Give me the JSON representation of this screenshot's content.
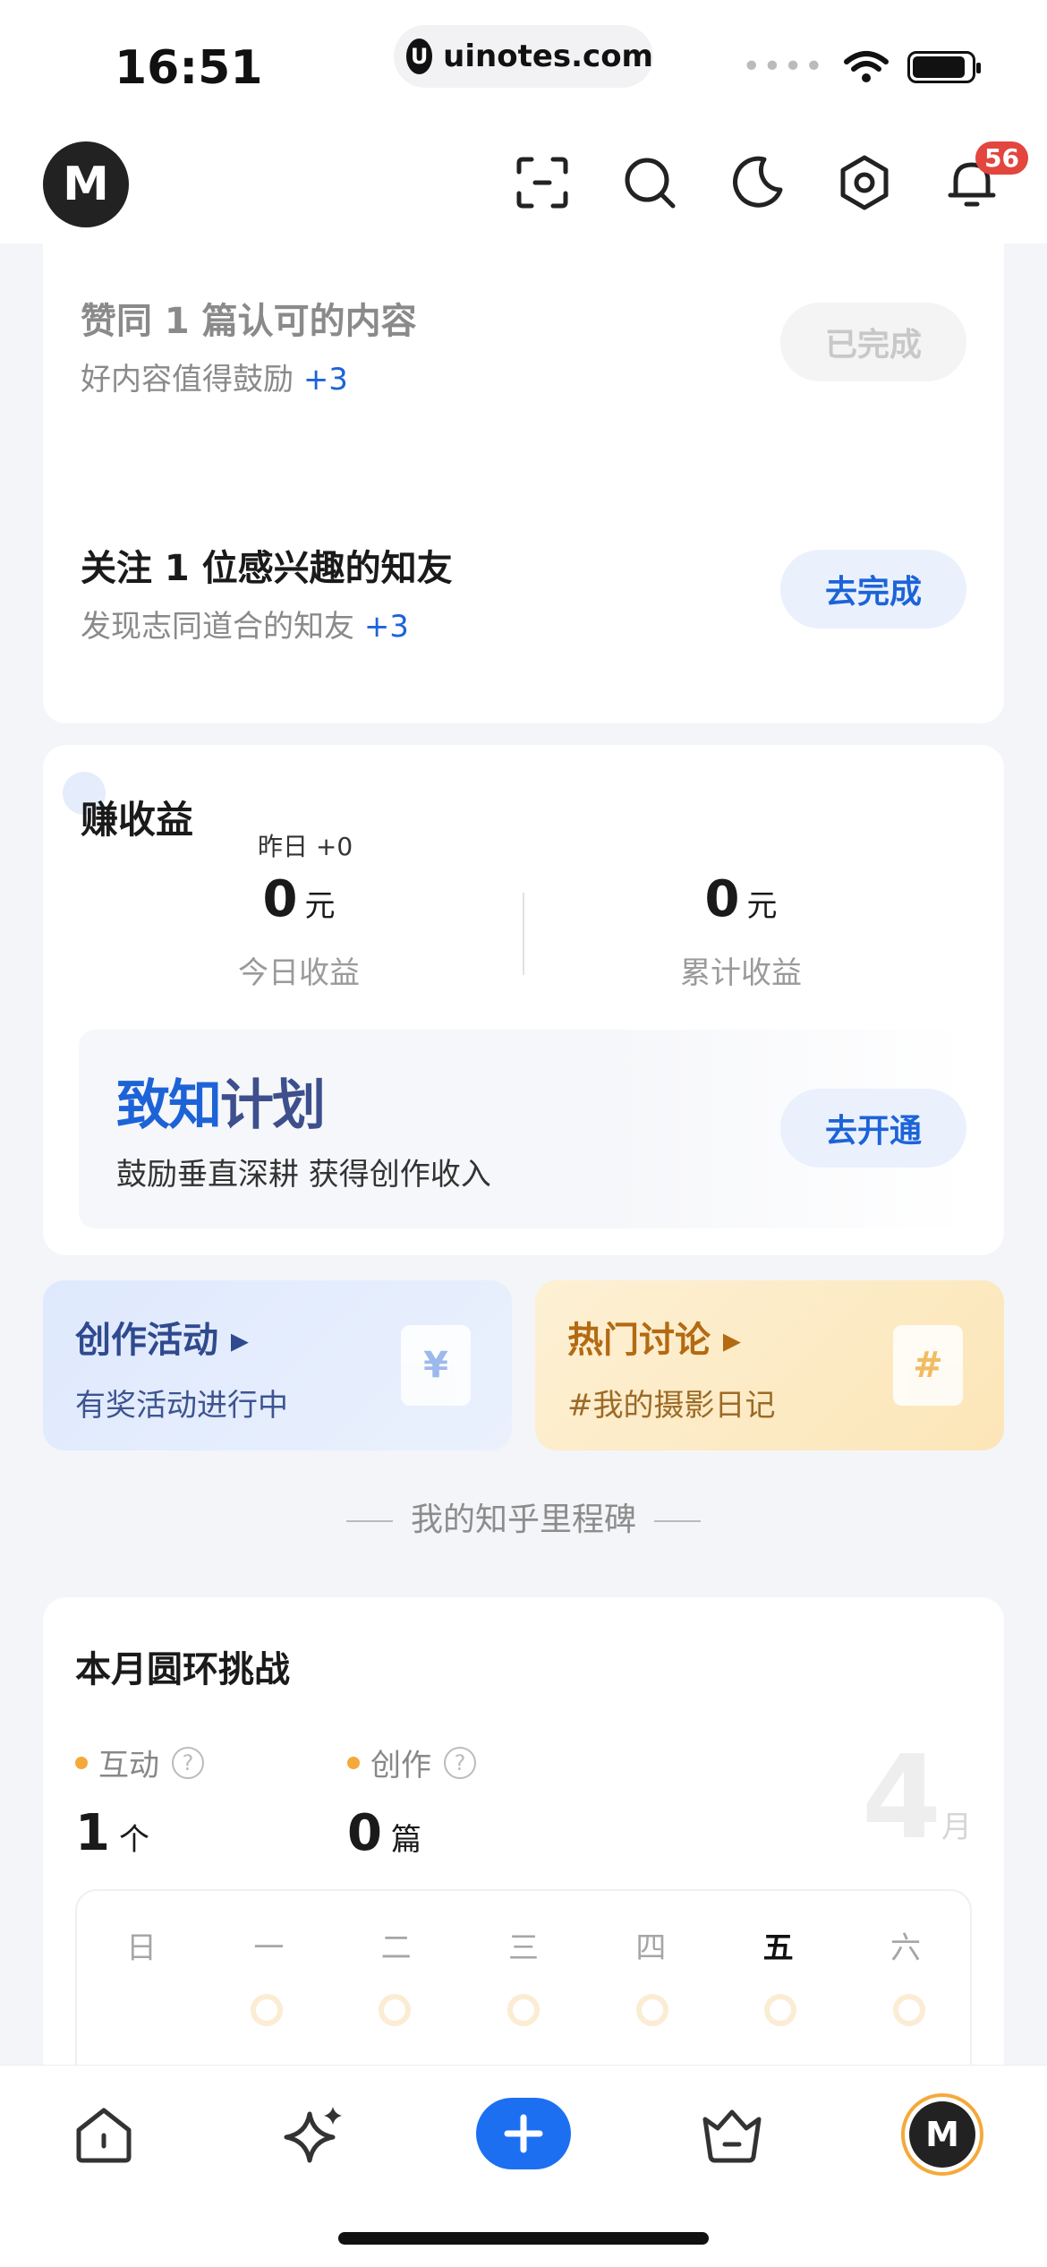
{
  "status_bar": {
    "time": "16:51",
    "url": "uinotes.com",
    "url_icon": "U"
  },
  "header": {
    "logo": "M",
    "notification_count": "56"
  },
  "tasks": [
    {
      "title": "赞同 1 篇认可的内容",
      "desc": "好内容值得鼓励",
      "bonus": "+3",
      "button": "已完成"
    },
    {
      "title": "关注 1 位感兴趣的知友",
      "desc": "发现志同道合的知友",
      "bonus": "+3",
      "button": "去完成"
    }
  ],
  "earnings": {
    "title": "赚收益",
    "yesterday": "昨日 +0",
    "today": {
      "value": "0",
      "unit": "元",
      "label": "今日收益"
    },
    "total": {
      "value": "0",
      "unit": "元",
      "label": "累计收益"
    },
    "plan": {
      "title_a": "致知",
      "title_b": "计划",
      "subtitle": "鼓励垂直深耕 获得创作收入",
      "button": "去开通"
    }
  },
  "activities": [
    {
      "title": "创作活动",
      "subtitle": "有奖活动进行中",
      "art": "¥"
    },
    {
      "title": "热门讨论",
      "subtitle": "#我的摄影日记",
      "art": "#"
    }
  ],
  "milestone_header": "我的知乎里程碑",
  "ring_challenge": {
    "title": "本月圆环挑战",
    "interaction": {
      "label": "互动",
      "value": "1",
      "unit": "个"
    },
    "creation": {
      "label": "创作",
      "value": "0",
      "unit": "篇"
    },
    "month_number": "4",
    "month_unit": "月",
    "weekdays": [
      "日",
      "一",
      "二",
      "三",
      "四",
      "五",
      "六"
    ],
    "active_weekday": "五"
  },
  "bottom_nav": {
    "avatar": "M"
  },
  "colors": {
    "accent": "#1d63d8",
    "plus": "#1d6ff2",
    "badge": "#e2463f",
    "ring": "#f5a93a"
  }
}
